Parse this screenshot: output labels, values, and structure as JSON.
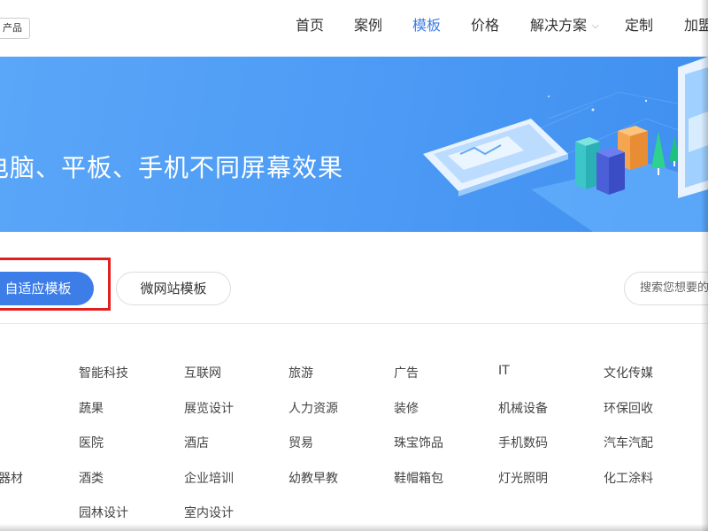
{
  "header": {
    "product_tag": "产品",
    "nav": [
      {
        "label": "首页",
        "active": false
      },
      {
        "label": "案例",
        "active": false
      },
      {
        "label": "模板",
        "active": true
      },
      {
        "label": "价格",
        "active": false
      },
      {
        "label": "解决方案",
        "active": false,
        "has_dropdown": true
      },
      {
        "label": "定制",
        "active": false
      },
      {
        "label": "加盟",
        "active": false
      }
    ],
    "dropdown_icon": "chevron-down-icon"
  },
  "banner": {
    "text": "电脑、平板、手机不同屏幕效果"
  },
  "tabs": {
    "primary": "自适应模板",
    "secondary": "微网站模板"
  },
  "search": {
    "placeholder": "搜索您想要的"
  },
  "categories": {
    "col0": [
      "器材"
    ],
    "col1": [
      "智能科技",
      "蔬果",
      "医院",
      "酒类",
      "园林设计"
    ],
    "col2": [
      "互联网",
      "展览设计",
      "酒店",
      "企业培训",
      "室内设计"
    ],
    "col3": [
      "旅游",
      "人力资源",
      "贸易",
      "幼教早教"
    ],
    "col4": [
      "广告",
      "装修",
      "珠宝饰品",
      "鞋帽箱包"
    ],
    "col5": [
      "IT",
      "机械设备",
      "手机数码",
      "灯光照明"
    ],
    "col6": [
      "文化传媒",
      "环保回收",
      "汽车汽配",
      "化工涂料"
    ]
  },
  "colors": {
    "accent": "#3d7de8",
    "highlight": "#e21f1f",
    "banner": "#4d9bf5"
  }
}
